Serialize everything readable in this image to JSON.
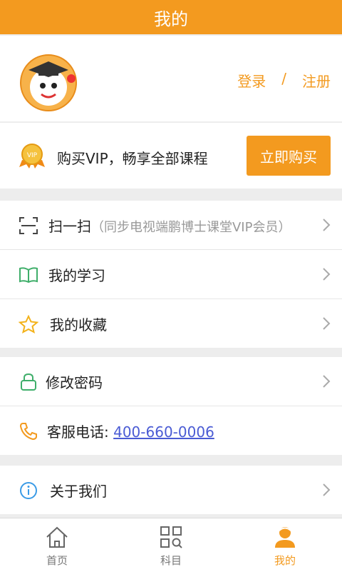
{
  "header": {
    "title": "我的"
  },
  "profile": {
    "avatar_icon": "cartoon-avatar-icon",
    "login": "登录",
    "divider": "/",
    "register": "注册"
  },
  "vip": {
    "icon": "vip-medal-icon",
    "text": "购买VIP，畅享全部课程",
    "button": "立即购买"
  },
  "menu": {
    "scan": {
      "label": "扫一扫",
      "sub": "（同步电视端鹏博士课堂VIP会员）"
    },
    "study": {
      "label": "我的学习"
    },
    "favorites": {
      "label": "我的收藏"
    },
    "password": {
      "label": "修改密码"
    },
    "service": {
      "label": "客服电话:",
      "phone": "400-660-0006"
    },
    "about": {
      "label": "关于我们"
    }
  },
  "tabbar": {
    "home": "首页",
    "subjects": "科目",
    "mine": "我的"
  },
  "colors": {
    "accent": "#f39a1f",
    "link": "#4a5bd4"
  }
}
